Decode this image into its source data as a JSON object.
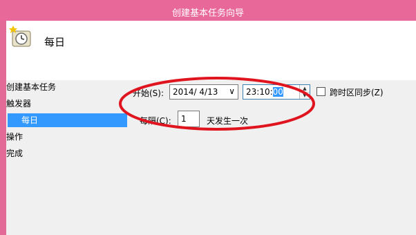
{
  "window": {
    "title": "创建基本任务向导"
  },
  "header": {
    "heading": "每日",
    "icon": "task-scheduler-clock-icon"
  },
  "nav": {
    "items": [
      {
        "label": "创建基本任务"
      },
      {
        "label": "触发器"
      },
      {
        "label": "每日"
      },
      {
        "label": "操作"
      },
      {
        "label": "完成"
      }
    ],
    "selected": "每日"
  },
  "form": {
    "start_label": "开始(S):",
    "start_date": "2014/  4/13",
    "date_dropdown_icon": "chevron-down-icon",
    "start_time_prefix": "23:10:",
    "start_time_selected": "00",
    "sync_timezone_label": "跨时区同步(Z)",
    "sync_timezone_checked": false,
    "recur_label": "每隔(C):",
    "recur_value": "1",
    "recur_suffix": "天发生一次"
  },
  "colors": {
    "titlebar": "#e8689a",
    "selection": "#3399ff",
    "annotation": "#e0141e"
  }
}
